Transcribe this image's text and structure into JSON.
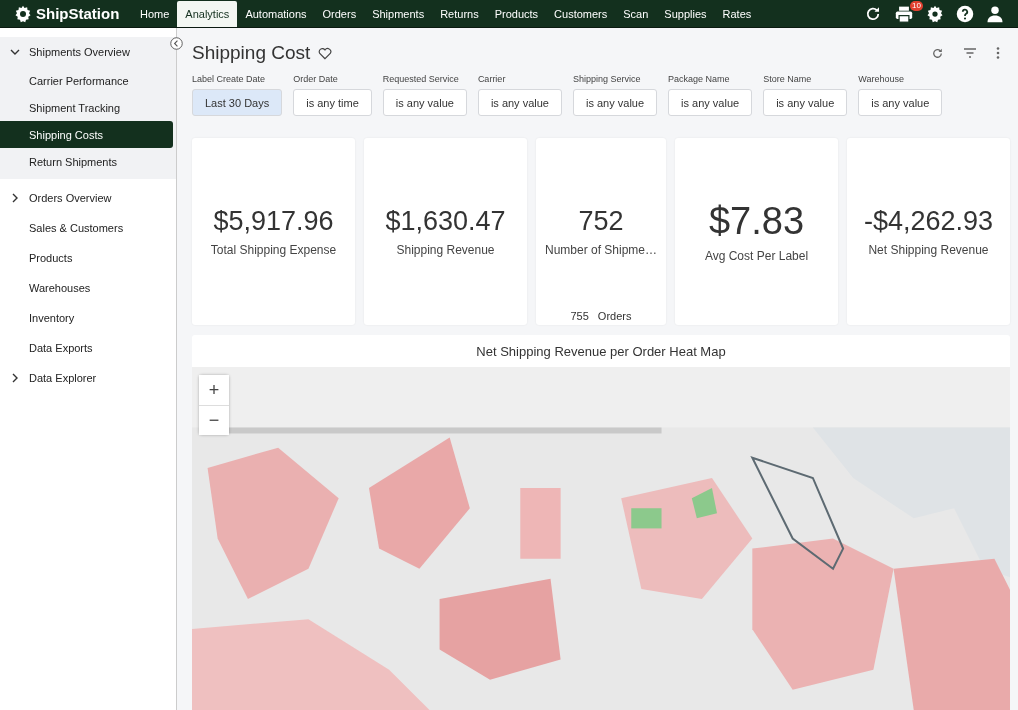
{
  "topbar": {
    "brand": "ShipStation",
    "nav": [
      {
        "label": "Home",
        "selected": false
      },
      {
        "label": "Analytics",
        "selected": true
      },
      {
        "label": "Automations",
        "selected": false
      },
      {
        "label": "Orders",
        "selected": false
      },
      {
        "label": "Shipments",
        "selected": false
      },
      {
        "label": "Returns",
        "selected": false
      },
      {
        "label": "Products",
        "selected": false
      },
      {
        "label": "Customers",
        "selected": false
      },
      {
        "label": "Scan",
        "selected": false
      },
      {
        "label": "Supplies",
        "selected": false
      },
      {
        "label": "Rates",
        "selected": false
      }
    ],
    "print_badge": "10"
  },
  "sidebar": {
    "items": [
      {
        "label": "Shipments Overview",
        "expanded": true,
        "children": [
          {
            "label": "Carrier Performance",
            "selected": false
          },
          {
            "label": "Shipment Tracking",
            "selected": false
          },
          {
            "label": "Shipping Costs",
            "selected": true
          },
          {
            "label": "Return Shipments",
            "selected": false
          }
        ]
      },
      {
        "label": "Orders Overview",
        "expanded": false
      },
      {
        "label": "Sales & Customers"
      },
      {
        "label": "Products"
      },
      {
        "label": "Warehouses"
      },
      {
        "label": "Inventory"
      },
      {
        "label": "Data Exports"
      },
      {
        "label": "Data Explorer",
        "expanded": false
      }
    ]
  },
  "page": {
    "title": "Shipping Cost",
    "filters": [
      {
        "label": "Label Create Date",
        "value": "Last 30 Days",
        "active": true
      },
      {
        "label": "Order Date",
        "value": "is any time",
        "active": false
      },
      {
        "label": "Requested Service",
        "value": "is any value",
        "active": false
      },
      {
        "label": "Carrier",
        "value": "is any value",
        "active": false
      },
      {
        "label": "Shipping Service",
        "value": "is any value",
        "active": false
      },
      {
        "label": "Package Name",
        "value": "is any value",
        "active": false
      },
      {
        "label": "Store Name",
        "value": "is any value",
        "active": false
      },
      {
        "label": "Warehouse",
        "value": "is any value",
        "active": false
      }
    ],
    "cards": [
      {
        "value": "$5,917.96",
        "label": "Total Shipping Expense",
        "emphasized": false
      },
      {
        "value": "$1,630.47",
        "label": "Shipping Revenue",
        "emphasized": false
      },
      {
        "value": "752",
        "label": "Number of Shipme…",
        "emphasized": false,
        "footer": {
          "count": "755",
          "unit": "Orders"
        }
      },
      {
        "value": "$7.83",
        "label": "Avg Cost Per Label",
        "emphasized": true
      },
      {
        "value": "-$4,262.93",
        "label": "Net Shipping Revenue",
        "emphasized": false
      }
    ],
    "map": {
      "title": "Net Shipping Revenue per Order Heat Map",
      "zoom_in": "+",
      "zoom_out": "−"
    }
  }
}
